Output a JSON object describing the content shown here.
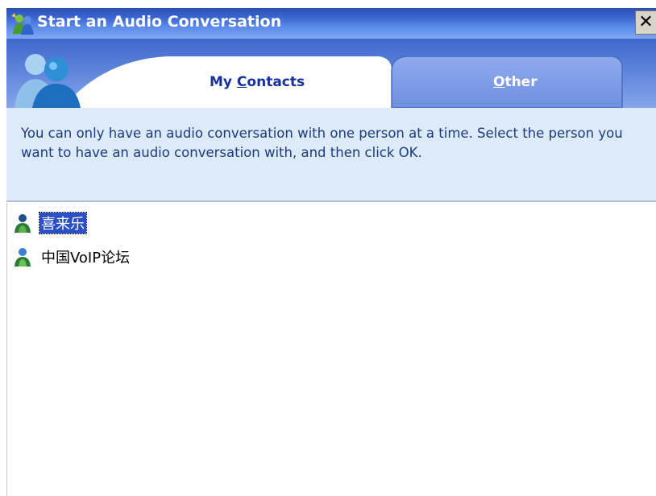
{
  "window": {
    "title": "Start an Audio Conversation",
    "close_label": "✕"
  },
  "tabs": [
    {
      "label_prefix": "My ",
      "label_accel": "C",
      "label_suffix": "ontacts",
      "active": true
    },
    {
      "label_prefix": "",
      "label_accel": "O",
      "label_suffix": "ther",
      "active": false
    }
  ],
  "message": "You can only have an audio conversation with one person at a time.  Select the person you want to have an audio conversation with, and then click OK.",
  "contacts": [
    {
      "name": "喜来乐",
      "selected": true,
      "icon": "buddy-icon"
    },
    {
      "name": "中国VoIP论坛",
      "selected": false,
      "icon": "buddy-icon"
    }
  ],
  "colors": {
    "titlebar": "#3b66d0",
    "tab_band": "#5a7fd6",
    "message_bg": "#ddeaf8",
    "selection": "#2b4fc4"
  },
  "icons": [
    "messenger-app-icon",
    "close-icon",
    "messenger-logo-icon",
    "buddy-icon"
  ]
}
